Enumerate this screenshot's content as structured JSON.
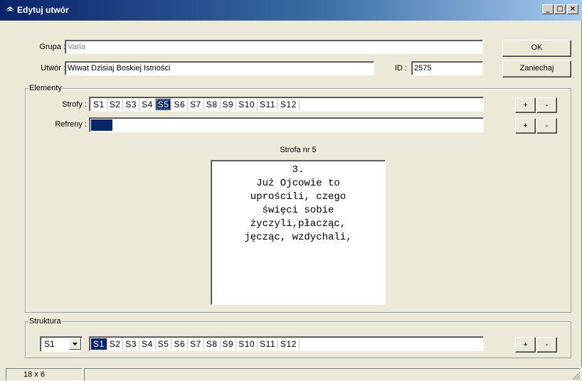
{
  "window": {
    "title": "Edytuj utwór",
    "minimize": "_",
    "maximize": "□",
    "close": "×"
  },
  "form": {
    "grupa_label": "Grupa :",
    "grupa_value": "Varia",
    "utwor_label": "Utwór :",
    "utwor_value": "Wiwat Dzisiaj Boskiej Istności",
    "id_label": "ID :",
    "id_value": "2575",
    "ok_label": "OK",
    "cancel_label": "Zaniechaj"
  },
  "elementy": {
    "title": "Elementy",
    "strofy_label": "Strofy :",
    "strofy": [
      "S1",
      "S2",
      "S3",
      "S4",
      "S5",
      "S6",
      "S7",
      "S8",
      "S9",
      "S10",
      "S11",
      "S12"
    ],
    "strofy_selected": "S5",
    "refreny_label": "Refreny :",
    "plus": "+",
    "minus": "-"
  },
  "preview": {
    "caption": "Strofa nr 5",
    "lines": [
      "3.",
      "Już Ojcowie to",
      "uprościli, czego",
      "święci sobie",
      "życzyli,płacząc,",
      "jęcząc, wzdychali,"
    ]
  },
  "struktura": {
    "title": "Struktura",
    "select_value": "S1",
    "items": [
      "S1",
      "S2",
      "S3",
      "S4",
      "S5",
      "S6",
      "S7",
      "S8",
      "S9",
      "S10",
      "S11",
      "S12"
    ],
    "selected": "S1",
    "plus": "+",
    "minus": "-"
  },
  "status": {
    "size": "18 x 6"
  },
  "colors": {
    "selection": "#0a246a",
    "window_bg": "#ece9d8"
  }
}
